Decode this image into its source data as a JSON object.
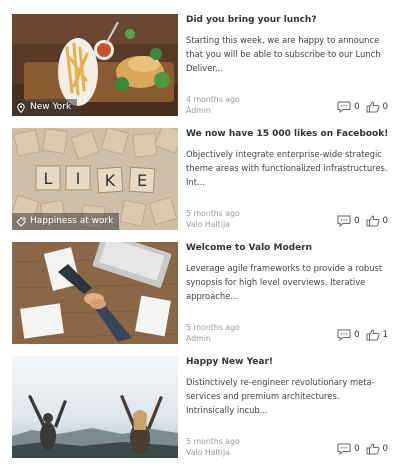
{
  "articles": [
    {
      "title": "Did you bring your lunch?",
      "excerpt": "Starting this week, we are happy to announce that you will be able to subscribe to our Lunch Deliver...",
      "age": "4 months ago",
      "author": "Admin",
      "tag": "New York",
      "tag_icon": "location-pin-icon",
      "comments": "0",
      "likes": "0"
    },
    {
      "title": "We now have 15 000 likes on Facebook!",
      "excerpt": "Objectively integrate enterprise-wide strategic theme areas with functionalized infrastructures. Int...",
      "age": "5 months ago",
      "author": "Valo Haltija",
      "tag": "Happiness at work",
      "tag_icon": "tag-icon",
      "comments": "0",
      "likes": "0"
    },
    {
      "title": "Welcome to Valo Modern",
      "excerpt": "Leverage agile frameworks to provide a robust synopsis for high level overviews. Iterative approache...",
      "age": "5 months ago",
      "author": "Admin",
      "comments": "0",
      "likes": "1"
    },
    {
      "title": "Happy New Year!",
      "excerpt": "Distinctively re-engineer revolutionary meta-services and premium architectures. Intrinsically incub...",
      "age": "5 months ago",
      "author": "Valo Haltija",
      "comments": "0",
      "likes": "0"
    }
  ],
  "icons": {
    "comment": "comment-icon",
    "like": "thumbs-up-icon"
  }
}
